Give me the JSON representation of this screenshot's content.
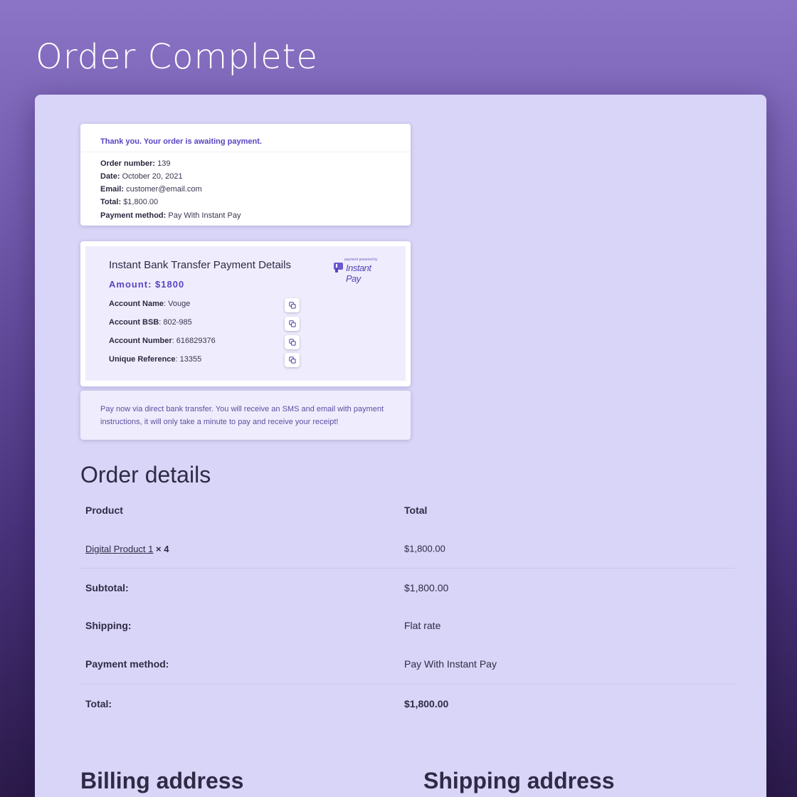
{
  "page": {
    "title": "Order Complete"
  },
  "summary": {
    "message": "Thank you. Your order is awaiting payment.",
    "lines": [
      {
        "label": "Order number:",
        "value": "139"
      },
      {
        "label": "Date:",
        "value": "October 20, 2021"
      },
      {
        "label": "Email:",
        "value": "customer@email.com"
      },
      {
        "label": "Total:",
        "value": "$1,800.00"
      },
      {
        "label": "Payment method:",
        "value": "Pay With Instant Pay"
      }
    ]
  },
  "bank": {
    "title": "Instant Bank Transfer Payment Details",
    "logo_small": "payment powered by",
    "logo_text": "Instant Pay",
    "amount": "Amount: $1800",
    "rows": [
      {
        "label": "Account Name",
        "value": ": Vouge"
      },
      {
        "label": "Account BSB",
        "value": ": 802-985"
      },
      {
        "label": "Account Number",
        "value": ": 616829376"
      },
      {
        "label": "Unique Reference",
        "value": ": 13355"
      }
    ]
  },
  "note": {
    "text": "Pay now via direct bank transfer. You will receive an SMS and email with payment instructions, it will only take a minute to pay and receive your receipt!"
  },
  "order_details": {
    "heading": "Order details",
    "header": {
      "product": "Product",
      "total": "Total"
    },
    "item": {
      "name": "Digital Product 1",
      "qty": " × 4",
      "total": "$1,800.00"
    },
    "rows": [
      {
        "label": "Subtotal:",
        "value": "$1,800.00"
      },
      {
        "label": "Shipping:",
        "value": "Flat rate"
      },
      {
        "label": "Payment method:",
        "value": "Pay With Instant Pay"
      },
      {
        "label": "Total:",
        "value": "$1,800.00"
      }
    ]
  },
  "addresses": {
    "billing_heading": "Billing address",
    "shipping_heading": "Shipping address"
  },
  "colors": {
    "accent": "#5b44c2",
    "panel": "#d9d5f8",
    "card_tint": "#efedfd"
  }
}
